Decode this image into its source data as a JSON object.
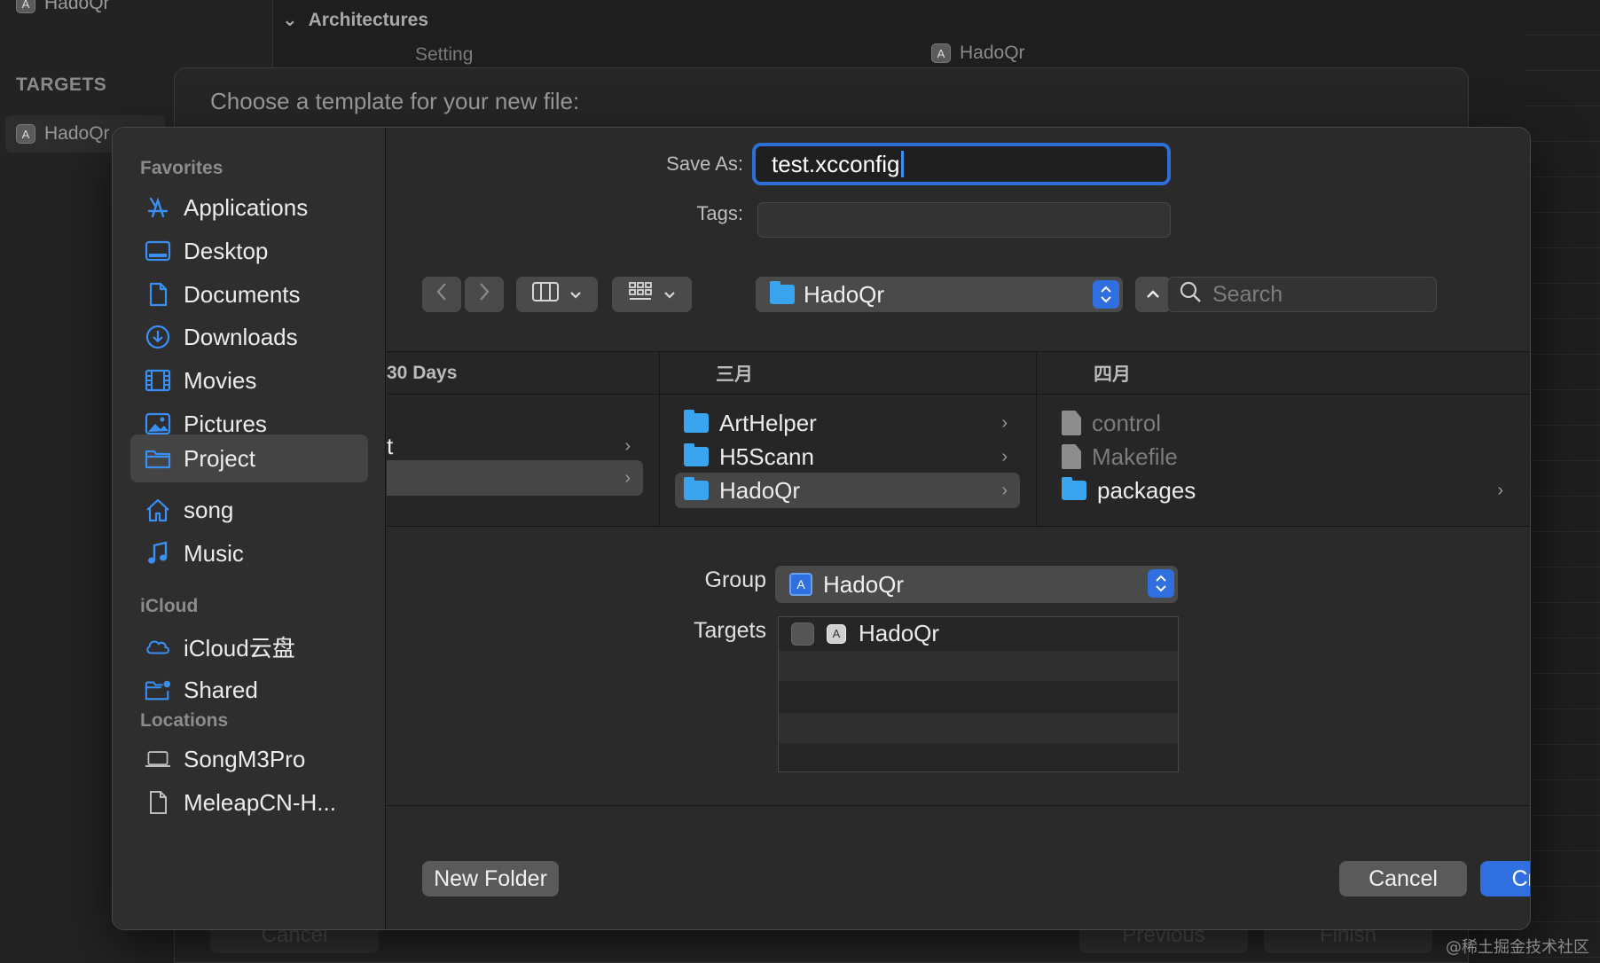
{
  "background": {
    "top_item": "HadoQr",
    "targets_header": "TARGETS",
    "target_item": "HadoQr",
    "section_title": "Architectures",
    "column_setting": "Setting",
    "column_target": "HadoQr",
    "template_title": "Choose a template for your new file:",
    "cancel_label": "Cancel",
    "previous_label": "Previous",
    "finish_label": "Finish"
  },
  "save_panel": {
    "save_as_label": "Save As:",
    "save_as_value": "test.xcconfig",
    "tags_label": "Tags:",
    "path_popup": "HadoQr",
    "search_placeholder": "Search",
    "group_label": "Group",
    "group_value": "HadoQr",
    "targets_label": "Targets",
    "target_name": "HadoQr",
    "target_checked": false,
    "new_folder_label": "New Folder",
    "cancel_label": "Cancel",
    "create_label": "Create"
  },
  "sidebar": {
    "favorites_header": "Favorites",
    "favorites": [
      {
        "label": "Applications",
        "icon": "applications-icon"
      },
      {
        "label": "Desktop",
        "icon": "desktop-icon"
      },
      {
        "label": "Documents",
        "icon": "document-icon"
      },
      {
        "label": "Downloads",
        "icon": "downloads-icon"
      },
      {
        "label": "Movies",
        "icon": "movies-icon"
      },
      {
        "label": "Pictures",
        "icon": "pictures-icon"
      },
      {
        "label": "Project",
        "icon": "folder-icon",
        "selected": true
      },
      {
        "label": "song",
        "icon": "home-icon"
      },
      {
        "label": "Music",
        "icon": "music-icon"
      }
    ],
    "icloud_header": "iCloud",
    "icloud": [
      {
        "label": "iCloud云盘",
        "icon": "cloud-icon"
      },
      {
        "label": "Shared",
        "icon": "shared-folder-icon"
      }
    ],
    "locations_header": "Locations",
    "locations": [
      {
        "label": "SongM3Pro",
        "icon": "laptop-icon"
      },
      {
        "label": "MeleapCN-H...",
        "icon": "document-icon"
      }
    ]
  },
  "browser": {
    "col1": {
      "header": "30 Days",
      "row1": "t",
      "row2": ""
    },
    "col2": {
      "header": "三月",
      "items": [
        "ArtHelper",
        "H5Scann",
        "HadoQr"
      ]
    },
    "col3": {
      "header": "四月",
      "items": [
        "control",
        "Makefile",
        "packages"
      ]
    }
  },
  "watermark": "@稀土掘金技术社区",
  "colors": {
    "accent": "#2f6fe0",
    "folder": "#3aa4ee"
  }
}
